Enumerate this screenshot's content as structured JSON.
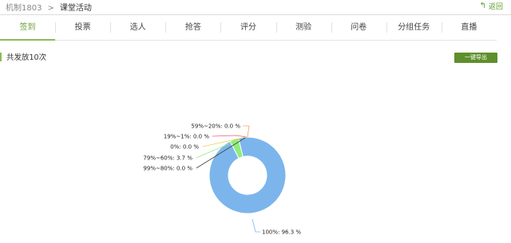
{
  "breadcrumb": {
    "course": "机制1803",
    "separator": ">",
    "current": "课堂活动"
  },
  "back_label": "返回",
  "tabs": [
    {
      "label": "签到",
      "active": true
    },
    {
      "label": "投票",
      "active": false
    },
    {
      "label": "选人",
      "active": false
    },
    {
      "label": "抢答",
      "active": false
    },
    {
      "label": "评分",
      "active": false
    },
    {
      "label": "测验",
      "active": false
    },
    {
      "label": "问卷",
      "active": false
    },
    {
      "label": "分组任务",
      "active": false
    },
    {
      "label": "直播",
      "active": false
    }
  ],
  "summary_text": "共发放10次",
  "export_button": "一键导出",
  "colors": {
    "accent_green": "#8bbd55",
    "button_green": "#5f8f2c"
  },
  "chart_data": {
    "type": "pie",
    "variant": "donut",
    "categories": [
      "100%",
      "79%~60%",
      "59%~20%",
      "19%~1%",
      "0%",
      "99%~80%"
    ],
    "values": [
      96.3,
      3.7,
      0.0,
      0.0,
      0.0,
      0.0
    ],
    "labels": [
      "100%: 96.3 %",
      "79%~60%: 3.7 %",
      "59%~20%: 0.0 %",
      "19%~1%: 0.0 %",
      "0%: 0.0 %",
      "99%~80%: 0.0 %"
    ],
    "colors": [
      "#7cb5ec",
      "#90ed7d",
      "#f7a35c",
      "#f15c80",
      "#e4d354",
      "#434348"
    ],
    "title": "",
    "legend": "none"
  }
}
